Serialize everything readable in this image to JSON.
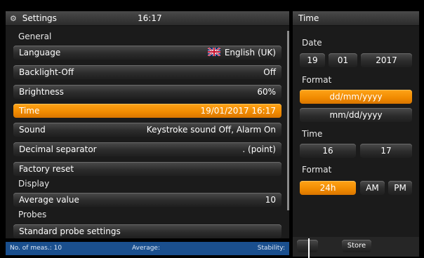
{
  "header": {
    "title": "Settings",
    "time": "16:17",
    "right_title": "Time"
  },
  "sections": {
    "general": "General",
    "display": "Display",
    "probes": "Probes"
  },
  "rows": {
    "language": {
      "label": "Language",
      "value": "English (UK)"
    },
    "backlight": {
      "label": "Backlight-Off",
      "value": "Off"
    },
    "brightness": {
      "label": "Brightness",
      "value": "60%"
    },
    "time": {
      "label": "Time",
      "value": "19/01/2017 16:17"
    },
    "sound": {
      "label": "Sound",
      "value": "Keystroke sound Off, Alarm On"
    },
    "decimal": {
      "label": "Decimal separator",
      "value": ". (point)"
    },
    "factory": {
      "label": "Factory reset",
      "value": ""
    },
    "average": {
      "label": "Average value",
      "value": "10"
    },
    "probe_settings": {
      "label": "Standard probe settings",
      "value": ""
    }
  },
  "status": {
    "meas": "No. of meas.: 10",
    "average": "Average:",
    "stability": "Stability:"
  },
  "time_panel": {
    "date_label": "Date",
    "day": "19",
    "month": "01",
    "year": "2017",
    "format_label": "Format",
    "format_ddmm": "dd/mm/yyyy",
    "format_mmdd": "mm/dd/yyyy",
    "time_label": "Time",
    "hour": "16",
    "minute": "17",
    "time_format_label": "Format",
    "h24": "24h",
    "am": "AM",
    "pm": "PM"
  },
  "bottom": {
    "store": "Store"
  },
  "colors": {
    "accent": "#f08a00",
    "status_bar": "#1a4f8e"
  }
}
